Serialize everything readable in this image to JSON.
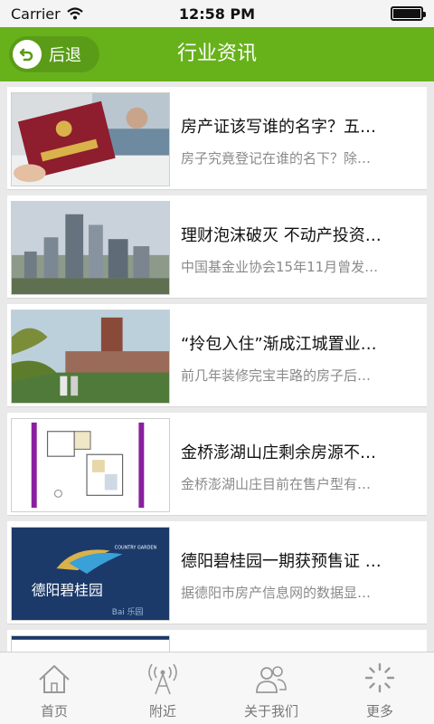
{
  "status_bar": {
    "carrier": "Carrier",
    "time": "12:58 PM"
  },
  "header": {
    "back_label": "后退",
    "title": "行业资讯"
  },
  "colors": {
    "header_green": "#67b21b",
    "back_button_green": "#5a9c17"
  },
  "articles": [
    {
      "title": "房产证该写谁的名字？五…",
      "desc": "房子究竟登记在谁的名下？除…",
      "thumb": "property-certificate"
    },
    {
      "title": "理财泡沫破灭 不动产投资…",
      "desc": "中国基金业协会15年11月曾发…",
      "thumb": "city-towers"
    },
    {
      "title": "“拎包入住”渐成江城置业…",
      "desc": "前几年装修完宝丰路的房子后…",
      "thumb": "residential-garden"
    },
    {
      "title": "金桥澎湖山庄剩余房源不…",
      "desc": "金桥澎湖山庄目前在售户型有…",
      "thumb": "floor-plan"
    },
    {
      "title": "德阳碧桂园一期获预售证 …",
      "desc": "据德阳市房产信息网的数据显…",
      "thumb": "country-garden-logo"
    }
  ],
  "thumb_text": {
    "garden_cn": "德阳碧桂园",
    "garden_en": "COUNTRY GARDEN",
    "watermark": "Bai 乐园"
  },
  "tabs": [
    {
      "label": "首页",
      "icon": "home-icon"
    },
    {
      "label": "附近",
      "icon": "signal-tower-icon"
    },
    {
      "label": "关于我们",
      "icon": "people-icon"
    },
    {
      "label": "更多",
      "icon": "more-icon"
    }
  ]
}
